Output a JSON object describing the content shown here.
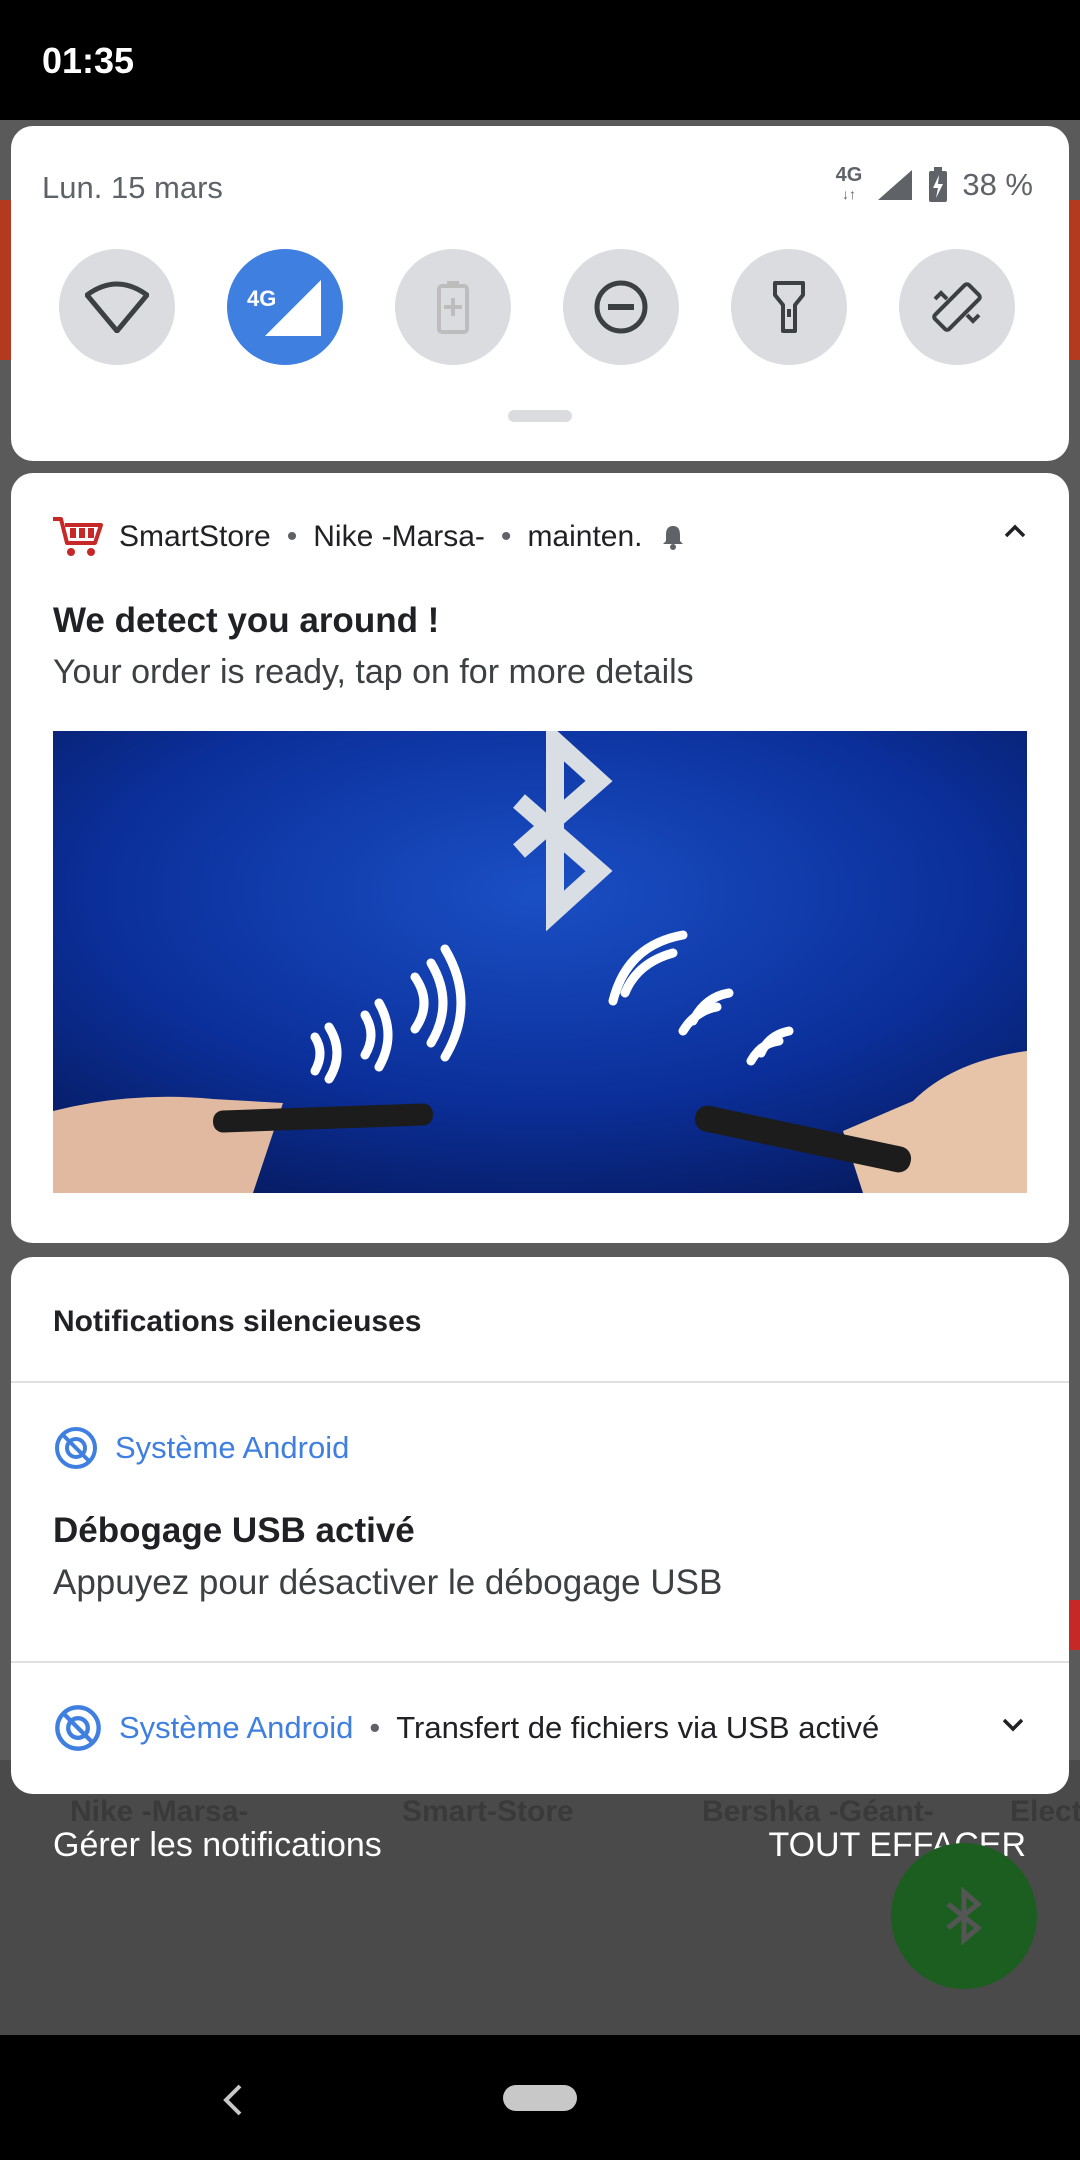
{
  "status_bar": {
    "time": "01:35"
  },
  "quick_settings": {
    "date": "Lun. 15 mars",
    "network_type": "4G",
    "battery_percent": "38 %",
    "tiles": [
      {
        "name": "wifi",
        "active": false
      },
      {
        "name": "mobile-data",
        "label": "4G",
        "active": true
      },
      {
        "name": "battery-saver",
        "active": false
      },
      {
        "name": "do-not-disturb",
        "active": false
      },
      {
        "name": "flashlight",
        "active": false
      },
      {
        "name": "auto-rotate",
        "active": false
      }
    ]
  },
  "notification": {
    "app": "SmartStore",
    "subtext": "Nike -Marsa-",
    "time": "mainten.",
    "title": "We detect you around !",
    "text": "Your order is ready, tap on for more details"
  },
  "silent": {
    "header": "Notifications silencieuses",
    "items": [
      {
        "app": "Système Android",
        "title": "Débogage USB activé",
        "text": "Appuyez pour désactiver le débogage USB"
      },
      {
        "app": "Système Android",
        "text": "Transfert de fichiers via USB activé"
      }
    ]
  },
  "background_app": {
    "labels": [
      "Nike -Marsa-",
      "Smart-Store",
      "Bershka -Géant-",
      "Elect"
    ]
  },
  "actions": {
    "manage": "Gérer les notifications",
    "clear_all": "TOUT EFFACER"
  },
  "colors": {
    "accent": "#3f7fe0",
    "fab": "#1b5e20",
    "card": "#ffffff"
  }
}
